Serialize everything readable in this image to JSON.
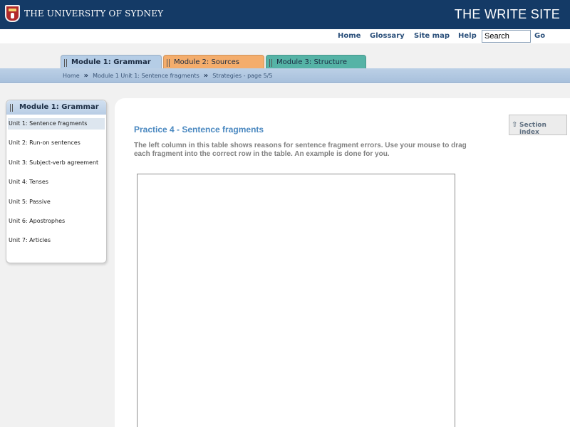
{
  "header": {
    "university": "THE UNIVERSITY OF SYDNEY",
    "site_title": "THE WRITE SITE"
  },
  "utility_nav": {
    "home": "Home",
    "glossary": "Glossary",
    "site_map": "Site map",
    "help": "Help",
    "search_value": "Search",
    "go": "Go"
  },
  "tabs": [
    {
      "label": "Module 1: Grammar",
      "color": "#b5cde6"
    },
    {
      "label": "Module 2: Sources",
      "color": "#f4ad6c"
    },
    {
      "label": "Module 3: Structure",
      "color": "#55b3a6"
    }
  ],
  "breadcrumb": {
    "home": "Home",
    "unit": "Module 1 Unit 1: Sentence fragments",
    "current": "Strategies - page 5/5"
  },
  "sidebar": {
    "title": "Module 1: Grammar",
    "items": [
      "Unit 1: Sentence fragments",
      "Unit 2: Run-on sentences",
      "Unit 3: Subject-verb agreement",
      "Unit 4: Tenses",
      "Unit 5: Passive",
      "Unit 6: Apostrophes",
      "Unit 7: Articles"
    ]
  },
  "main": {
    "heading": "Practice 4 - Sentence fragments",
    "instructions": "The left column in this table shows reasons for sentence fragment errors. Use your mouse to drag each fragment into the correct row in the table. An example is done for you.",
    "section_index": "Section index"
  }
}
